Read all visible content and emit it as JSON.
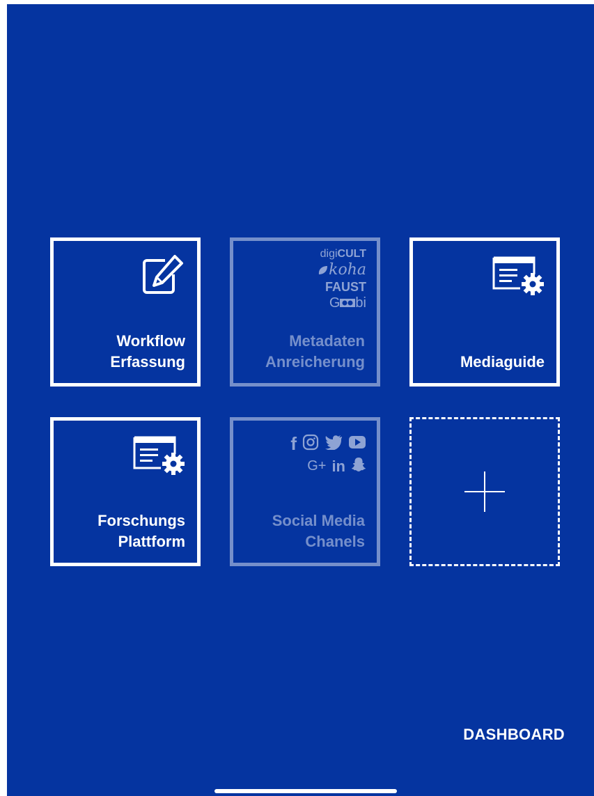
{
  "screen": {
    "background": "#0534a0",
    "accent": "#ffffff"
  },
  "tiles": [
    {
      "label": "Workflow\nErfassung",
      "icon": "edit-icon",
      "enabled": true
    },
    {
      "label": "Metadaten\nAnreicherung",
      "icon": "metadata-logos",
      "enabled": false,
      "brands": {
        "digicult_prefix": "digi",
        "digicult_suffix": "CULT",
        "koha": "koha",
        "faust": "FAUST",
        "goobi_g": "G",
        "goobi_rest": "bi"
      }
    },
    {
      "label": "Mediaguide",
      "icon": "settings-document-icon",
      "enabled": true
    },
    {
      "label": "Forschungs\nPlattform",
      "icon": "settings-document-icon",
      "enabled": true
    },
    {
      "label": "Social Media\nChanels",
      "icon": "social-icons",
      "enabled": false,
      "social": {
        "facebook": "f",
        "google_plus": "G+",
        "linkedin": "in"
      }
    },
    {
      "label": "",
      "icon": "plus-icon",
      "enabled": true
    }
  ],
  "footer": {
    "dashboard_label": "DASHBOARD"
  }
}
